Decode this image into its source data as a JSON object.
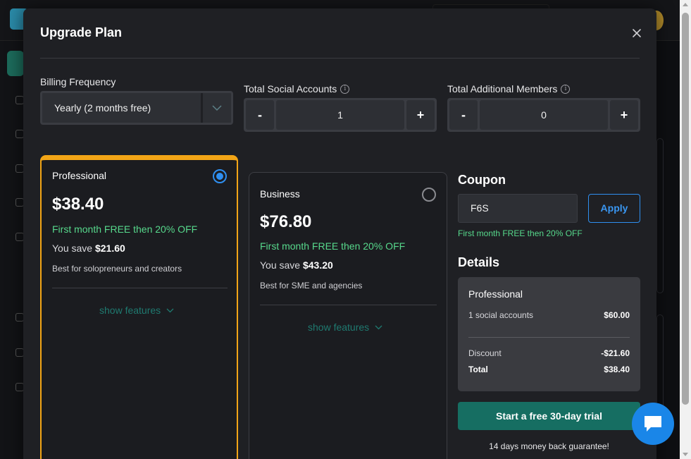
{
  "modal": {
    "title": "Upgrade Plan"
  },
  "billing": {
    "label": "Billing Frequency",
    "selected": "Yearly (2 months free)"
  },
  "social_accounts": {
    "label": "Total Social Accounts",
    "value": "1",
    "minus": "-",
    "plus": "+"
  },
  "members": {
    "label": "Total Additional Members",
    "value": "0",
    "minus": "-",
    "plus": "+"
  },
  "plans": [
    {
      "name": "Professional",
      "price": "$38.40",
      "offer": "First month FREE then 20% OFF",
      "save_prefix": "You save",
      "save_amount": "$21.60",
      "description": "Best for solopreneurs and creators",
      "show_features": "show features",
      "selected": true
    },
    {
      "name": "Business",
      "price": "$76.80",
      "offer": "First month FREE then 20% OFF",
      "save_prefix": "You save",
      "save_amount": "$43.20",
      "description": "Best for SME and agencies",
      "show_features": "show features",
      "selected": false
    }
  ],
  "coupon": {
    "title": "Coupon",
    "value": "F6S",
    "apply_label": "Apply",
    "message": "First month FREE then 20% OFF"
  },
  "details": {
    "title": "Details",
    "plan_name": "Professional",
    "line_label": "1 social accounts",
    "line_amount": "$60.00",
    "discount_label": "Discount",
    "discount_amount": "-$21.60",
    "total_label": "Total",
    "total_amount": "$38.40"
  },
  "cta": {
    "label": "Start a free 30-day trial",
    "guarantee": "14 days money back guarantee!"
  },
  "colors": {
    "accent_orange": "#f2a516",
    "accent_blue": "#2f8ff0",
    "offer_green": "#57d98c",
    "cta_teal": "#166e62"
  }
}
